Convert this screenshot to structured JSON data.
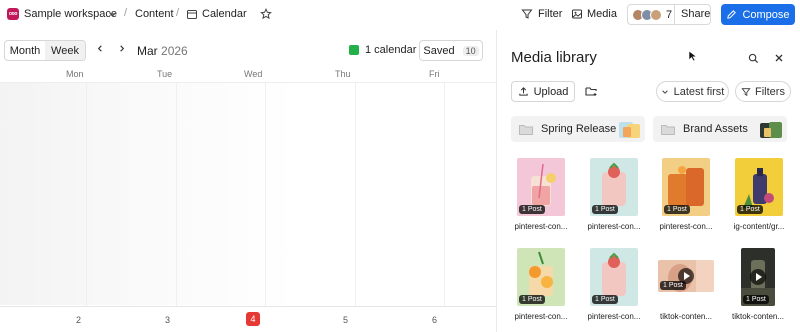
{
  "topbar": {
    "logo_text": "ooo",
    "workspace": "Sample workspace",
    "breadcrumb_sep": "/",
    "content": "Content",
    "calendar": "Calendar",
    "filter": "Filter",
    "media": "Media",
    "members_count": "7",
    "share": "Share",
    "compose": "Compose"
  },
  "calendar_toolbar": {
    "month_btn": "Month",
    "week_btn": "Week",
    "month_name": "Mar",
    "year": "2026",
    "calendar_count": "1 calendar",
    "saved_label": "Saved",
    "saved_count": "10"
  },
  "days": [
    "Mon",
    "Tue",
    "Wed",
    "Thu",
    "Fri"
  ],
  "dates": [
    "2",
    "3",
    "4",
    "5",
    "6"
  ],
  "today_index": 2,
  "media_panel": {
    "title": "Media library",
    "upload": "Upload",
    "sort": "Latest first",
    "filters": "Filters",
    "folders": [
      "Spring Release",
      "Brand Assets"
    ],
    "items": [
      {
        "label": "pinterest-con...",
        "badge": "1 Post"
      },
      {
        "label": "pinterest-con...",
        "badge": "1 Post"
      },
      {
        "label": "pinterest-con...",
        "badge": "1 Post"
      },
      {
        "label": "ig-content/gr...",
        "badge": "1 Post"
      },
      {
        "label": "pinterest-con...",
        "badge": "1 Post"
      },
      {
        "label": "pinterest-con...",
        "badge": "1 Post"
      },
      {
        "label": "tiktok-conten...",
        "badge": "1 Post"
      },
      {
        "label": "tiktok-conten...",
        "badge": "1 Post"
      }
    ]
  },
  "colors": {
    "accent": "#1a6fe8",
    "calendar_dot": "#22b04b",
    "today": "#e53935",
    "logo": "#c2185b"
  }
}
